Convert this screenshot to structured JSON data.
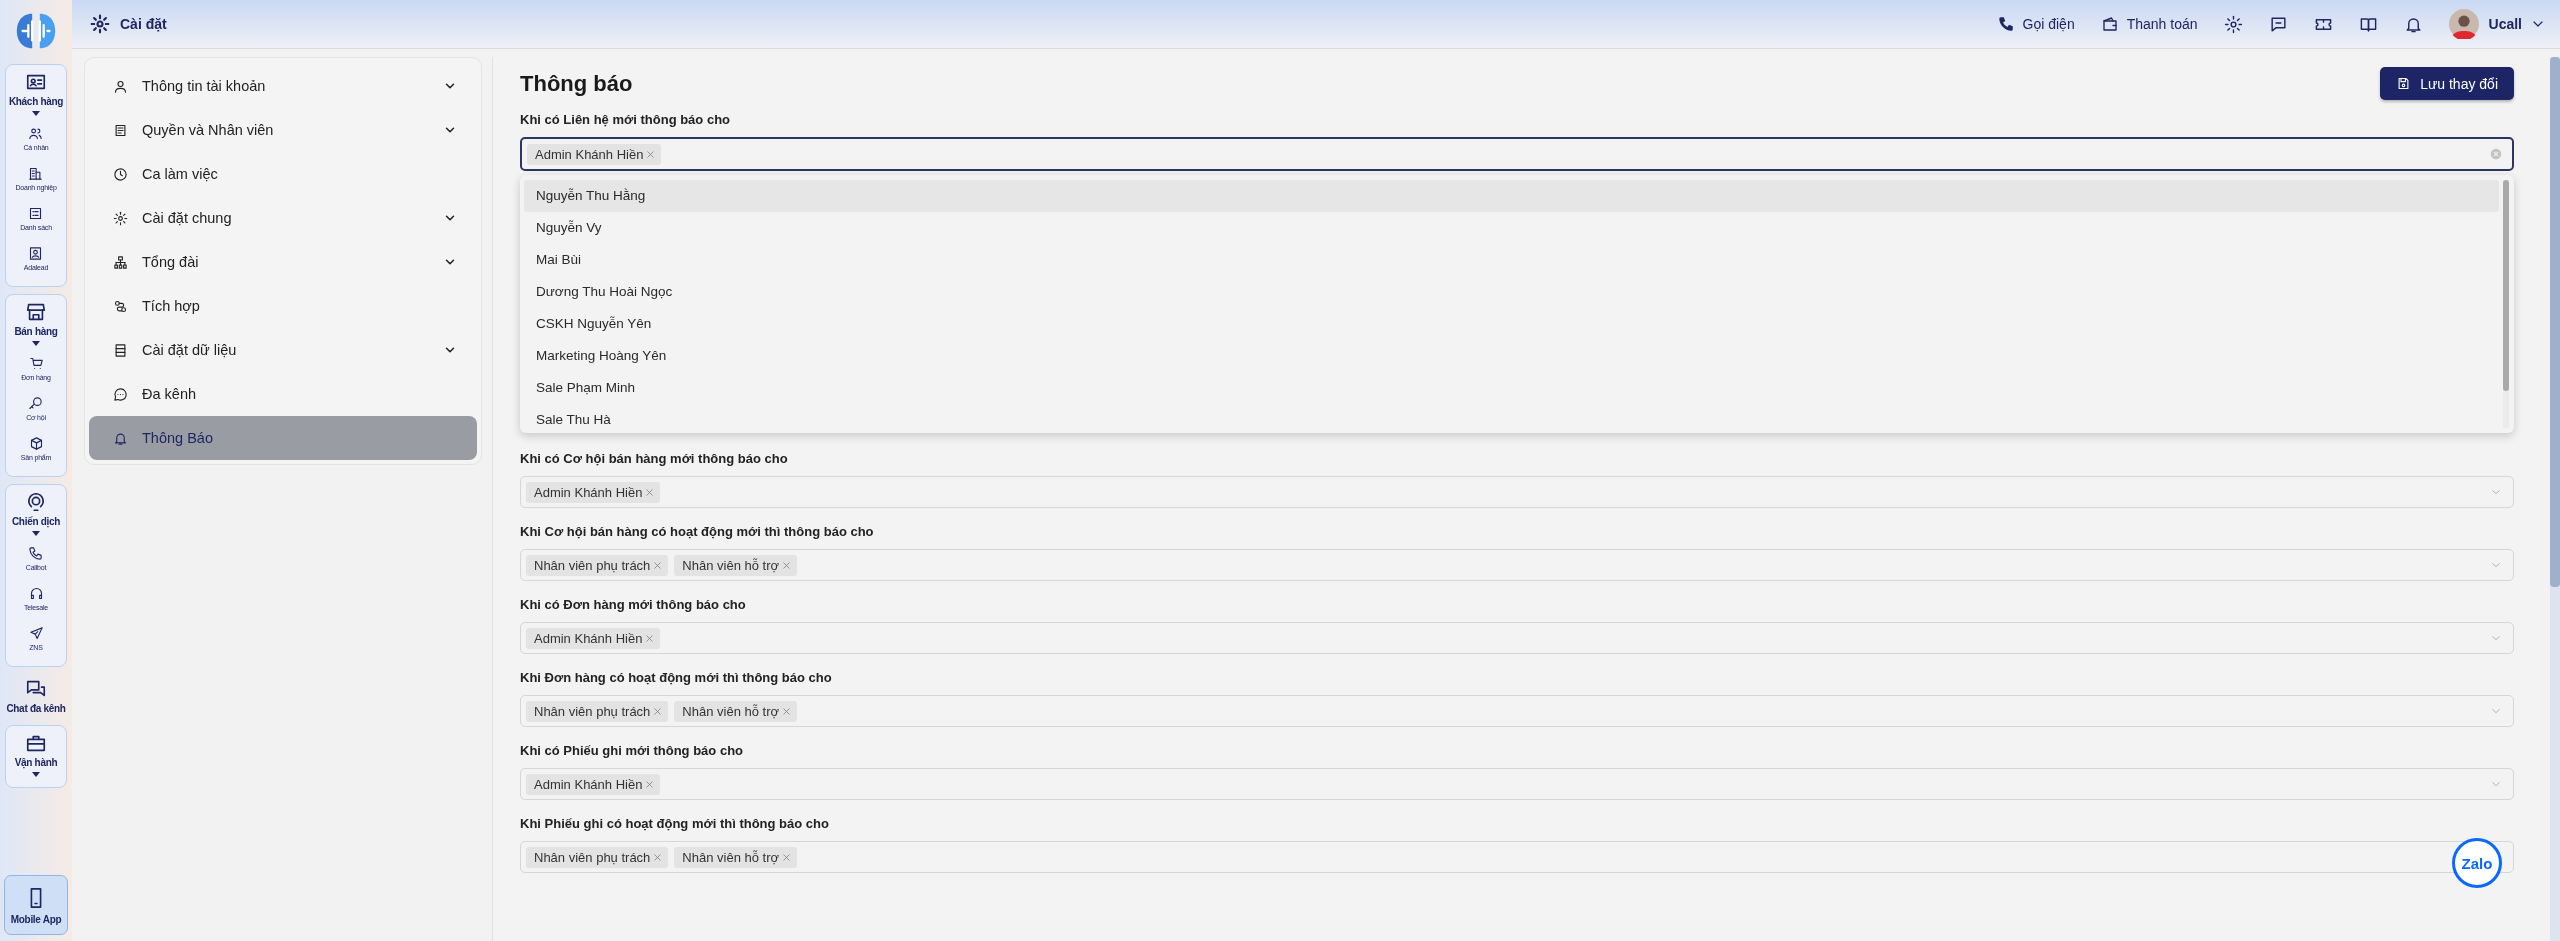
{
  "rail": {
    "entries": [
      {
        "kind": "group",
        "label": "Khách hàng",
        "items": [
          "Cá nhân",
          "Doanh nghiệp",
          "Danh sách",
          "Adalead"
        ]
      },
      {
        "kind": "group",
        "label": "Bán hàng",
        "items": [
          "Đơn hàng",
          "Cơ hội",
          "Sản phẩm"
        ]
      },
      {
        "kind": "group",
        "label": "Chiến dịch",
        "items": [
          "Callbot",
          "Telesale",
          "ZNS"
        ]
      },
      {
        "kind": "link",
        "label": "Chat đa kênh"
      },
      {
        "kind": "group",
        "label": "Vận hành"
      }
    ],
    "mobile_button": "Mobile App"
  },
  "header": {
    "title": "Cài đặt",
    "call_button": "Gọi điện",
    "payment_button": "Thanh toán",
    "user_name": "Ucall"
  },
  "sidebar": {
    "items": [
      {
        "label": "Thông tin tài khoản",
        "expandable": true,
        "selected": false
      },
      {
        "label": "Quyền và Nhân viên",
        "expandable": true,
        "selected": false
      },
      {
        "label": "Ca làm việc",
        "expandable": false,
        "selected": false
      },
      {
        "label": "Cài đặt chung",
        "expandable": true,
        "selected": false
      },
      {
        "label": "Tổng đài",
        "expandable": true,
        "selected": false
      },
      {
        "label": "Tích hợp",
        "expandable": false,
        "selected": false
      },
      {
        "label": "Cài đặt dữ liệu",
        "expandable": true,
        "selected": false
      },
      {
        "label": "Đa kênh",
        "expandable": false,
        "selected": false
      },
      {
        "label": "Thông Báo",
        "expandable": false,
        "selected": true
      }
    ]
  },
  "main": {
    "title": "Thông báo",
    "save_button": "Lưu thay đổi",
    "fields": [
      {
        "label": "Khi có Liên hệ mới thông báo cho",
        "tags": [
          "Admin Khánh Hiền"
        ],
        "open": true,
        "options": [
          {
            "label": "Nguyễn Thu Hằng",
            "selected": true
          },
          {
            "label": "Nguyễn Vy",
            "selected": false
          },
          {
            "label": "Mai Bùi",
            "selected": false
          },
          {
            "label": "Dương Thu Hoài Ngọc",
            "selected": false
          },
          {
            "label": "CSKH Nguyễn Yên",
            "selected": false
          },
          {
            "label": "Marketing Hoàng Yên",
            "selected": false
          },
          {
            "label": "Sale Phạm Minh",
            "selected": false
          },
          {
            "label": "Sale Thu Hà",
            "selected": false
          }
        ]
      },
      {
        "label": "Khi có Cơ hội bán hàng mới thông báo cho",
        "tags": [
          "Admin Khánh Hiền"
        ],
        "open": false
      },
      {
        "label": "Khi Cơ hội bán hàng có hoạt động mới thì thông báo cho",
        "tags": [
          "Nhân viên phụ trách",
          "Nhân viên hỗ trợ"
        ],
        "open": false
      },
      {
        "label": "Khi có Đơn hàng mới thông báo cho",
        "tags": [
          "Admin Khánh Hiền"
        ],
        "open": false
      },
      {
        "label": "Khi Đơn hàng có hoạt động mới thì thông báo cho",
        "tags": [
          "Nhân viên phụ trách",
          "Nhân viên hỗ trợ"
        ],
        "open": false
      },
      {
        "label": "Khi có Phiếu ghi mới thông báo cho",
        "tags": [
          "Admin Khánh Hiền"
        ],
        "open": false
      },
      {
        "label": "Khi Phiếu ghi có hoạt động mới thì thông báo cho",
        "tags": [
          "Nhân viên phụ trách",
          "Nhân viên hỗ trợ"
        ],
        "open": false
      }
    ]
  },
  "chat_widget": {
    "label": "Zalo"
  }
}
